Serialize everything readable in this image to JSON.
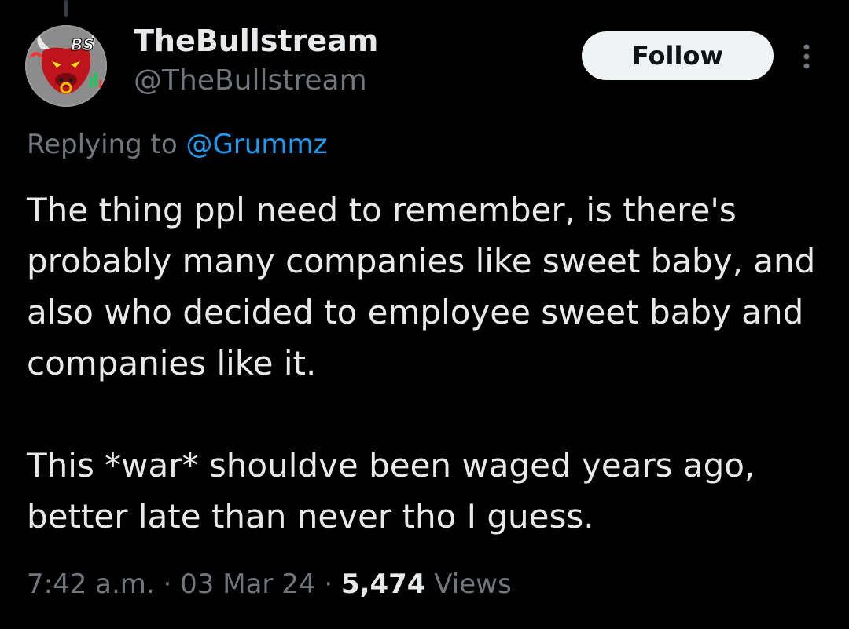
{
  "author": {
    "display_name": "TheBullstream",
    "handle": "@TheBullstream",
    "avatar_icon": "bull-logo-icon"
  },
  "actions": {
    "follow_label": "Follow",
    "more_icon": "more-vertical-icon"
  },
  "reply_context": {
    "prefix": "Replying to ",
    "mention": "@Grummz"
  },
  "tweet": {
    "paragraphs": [
      "The thing ppl need to remember, is there's probably many companies like sweet baby, and also who decided to employee sweet baby and companies like it.",
      "This *war* shouldve been waged years ago, better late than never tho I guess."
    ]
  },
  "meta": {
    "time": "7:42 a.m.",
    "separator": " · ",
    "date": "03 Mar 24",
    "views_count": "5,474",
    "views_label": " Views"
  },
  "colors": {
    "background": "#000000",
    "text_primary": "#e7e9ea",
    "text_secondary": "#71767b",
    "link": "#1d9bf0",
    "button_bg": "#eff3f4"
  }
}
